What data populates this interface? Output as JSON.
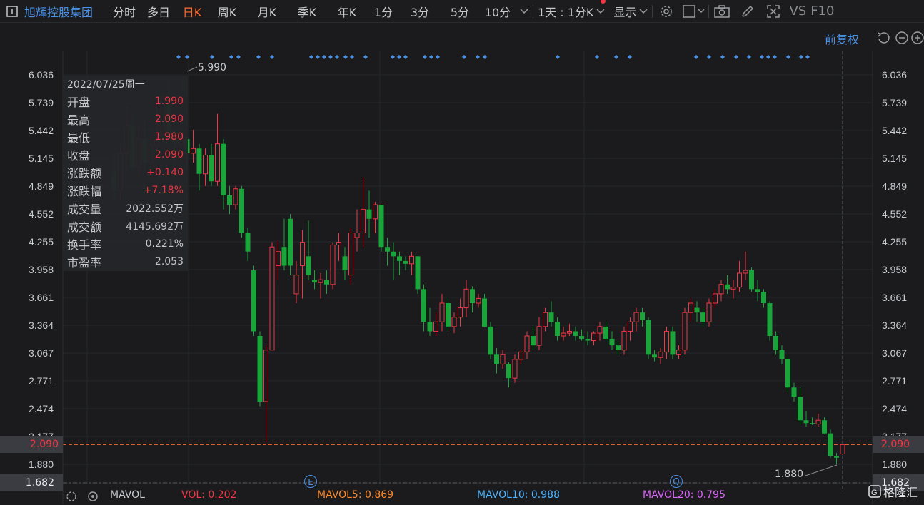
{
  "toolbar": {
    "title": "旭辉控股集团",
    "tabs": [
      "分时",
      "多日",
      "日K",
      "周K",
      "月K",
      "季K",
      "年K",
      "1分",
      "3分",
      "5分",
      "10分"
    ],
    "active_tab": "日K",
    "period": "1天 : 1分K",
    "display": "显示",
    "vs": "VS",
    "f10": "F10"
  },
  "subbar": {
    "fq": "前复权"
  },
  "info": {
    "date": "2022/07/25周一",
    "rows": [
      {
        "label": "开盘",
        "value": "1.990",
        "color": "#f23645"
      },
      {
        "label": "最高",
        "value": "2.090",
        "color": "#f23645"
      },
      {
        "label": "最低",
        "value": "1.980",
        "color": "#f23645"
      },
      {
        "label": "收盘",
        "value": "2.090",
        "color": "#f23645"
      },
      {
        "label": "涨跌额",
        "value": "+0.140",
        "color": "#f23645"
      },
      {
        "label": "涨跌幅",
        "value": "+7.18%",
        "color": "#f23645"
      },
      {
        "label": "成交量",
        "value": "2022.552万",
        "color": "#c9ccd1"
      },
      {
        "label": "成交额",
        "value": "4145.692万",
        "color": "#c9ccd1"
      },
      {
        "label": "换手率",
        "value": "0.221%",
        "color": "#c9ccd1"
      },
      {
        "label": "市盈率",
        "value": "2.053",
        "color": "#c9ccd1"
      }
    ]
  },
  "chart_data": {
    "type": "candlestick",
    "y_ticks": [
      "6.036",
      "5.739",
      "5.442",
      "5.145",
      "4.849",
      "4.552",
      "4.255",
      "3.958",
      "3.661",
      "3.364",
      "3.067",
      "2.771",
      "2.474",
      "2.177",
      "1.880",
      "1.682"
    ],
    "ylim": [
      1.682,
      6.036
    ],
    "current_price": "2.090",
    "low_marker": "1.682",
    "max_label": "5.990",
    "min_label": "1.880",
    "candles": [
      [
        5.0,
        5.2,
        4.7,
        4.8
      ],
      [
        4.8,
        5.3,
        4.7,
        5.2
      ],
      [
        5.2,
        5.7,
        5.0,
        5.5
      ],
      [
        5.5,
        5.6,
        5.0,
        5.05
      ],
      [
        5.05,
        5.5,
        4.95,
        5.35
      ],
      [
        5.35,
        5.55,
        5.0,
        5.1
      ],
      [
        5.1,
        5.35,
        5.0,
        5.28
      ],
      [
        5.28,
        5.72,
        5.2,
        5.4
      ],
      [
        5.4,
        5.85,
        5.3,
        5.8
      ],
      [
        5.8,
        5.99,
        5.3,
        5.35
      ],
      [
        5.35,
        5.45,
        5.1,
        5.3
      ],
      [
        5.3,
        5.4,
        5.15,
        5.35
      ],
      [
        5.35,
        5.38,
        5.05,
        5.2
      ],
      [
        5.2,
        5.45,
        5.1,
        5.25
      ],
      [
        5.25,
        5.3,
        4.8,
        4.98
      ],
      [
        4.98,
        5.25,
        4.85,
        5.18
      ],
      [
        5.18,
        5.3,
        4.85,
        4.9
      ],
      [
        4.9,
        5.62,
        4.85,
        5.3
      ],
      [
        5.3,
        5.35,
        4.6,
        4.75
      ],
      [
        4.75,
        4.85,
        4.55,
        4.65
      ],
      [
        4.65,
        4.85,
        4.6,
        4.82
      ],
      [
        4.82,
        4.85,
        4.3,
        4.35
      ],
      [
        4.35,
        4.4,
        4.05,
        4.15
      ],
      [
        3.95,
        4.0,
        3.25,
        3.3
      ],
      [
        3.25,
        3.3,
        2.5,
        2.55
      ],
      [
        2.55,
        3.15,
        2.12,
        3.1
      ],
      [
        3.1,
        4.25,
        3.1,
        4.2
      ],
      [
        4.0,
        4.27,
        3.85,
        4.15
      ],
      [
        4.2,
        4.5,
        3.95,
        4.0
      ],
      [
        4.5,
        4.55,
        3.9,
        4.0
      ],
      [
        3.7,
        4.05,
        3.6,
        3.9
      ],
      [
        4.0,
        4.38,
        3.65,
        4.25
      ],
      [
        4.1,
        4.48,
        3.85,
        3.9
      ],
      [
        3.85,
        3.95,
        3.75,
        3.82
      ],
      [
        3.82,
        3.92,
        3.65,
        3.85
      ],
      [
        3.85,
        3.95,
        3.7,
        3.8
      ],
      [
        3.8,
        4.25,
        3.75,
        4.22
      ],
      [
        4.22,
        4.35,
        4.05,
        4.25
      ],
      [
        4.1,
        4.2,
        3.85,
        3.95
      ],
      [
        3.9,
        4.4,
        3.8,
        4.35
      ],
      [
        4.3,
        4.6,
        4.15,
        4.35
      ],
      [
        4.35,
        4.94,
        4.2,
        4.6
      ],
      [
        4.6,
        4.8,
        4.3,
        4.5
      ],
      [
        4.5,
        4.68,
        4.35,
        4.65
      ],
      [
        4.65,
        4.65,
        4.15,
        4.2
      ],
      [
        4.2,
        4.3,
        4.0,
        4.15
      ],
      [
        4.15,
        4.25,
        3.85,
        4.1
      ],
      [
        4.1,
        4.15,
        3.9,
        4.05
      ],
      [
        4.05,
        4.1,
        3.95,
        4.02
      ],
      [
        4.02,
        4.15,
        3.9,
        4.1
      ],
      [
        4.1,
        4.1,
        3.7,
        3.75
      ],
      [
        3.75,
        3.8,
        3.3,
        3.4
      ],
      [
        3.4,
        3.55,
        3.25,
        3.3
      ],
      [
        3.3,
        3.5,
        3.25,
        3.4
      ],
      [
        3.4,
        3.7,
        3.3,
        3.6
      ],
      [
        3.6,
        3.65,
        3.3,
        3.35
      ],
      [
        3.35,
        3.5,
        3.28,
        3.45
      ],
      [
        3.45,
        3.65,
        3.35,
        3.55
      ],
      [
        3.55,
        3.85,
        3.45,
        3.75
      ],
      [
        3.75,
        3.78,
        3.5,
        3.6
      ],
      [
        3.6,
        3.7,
        3.55,
        3.65
      ],
      [
        3.65,
        3.7,
        3.35,
        3.35
      ],
      [
        3.35,
        3.4,
        3.0,
        3.05
      ],
      [
        3.05,
        3.12,
        2.85,
        2.95
      ],
      [
        2.95,
        3.1,
        2.9,
        3.05
      ],
      [
        2.95,
        2.97,
        2.7,
        2.8
      ],
      [
        2.8,
        3.05,
        2.75,
        3.0
      ],
      [
        3.0,
        3.1,
        2.95,
        3.08
      ],
      [
        3.08,
        3.3,
        3.0,
        3.25
      ],
      [
        3.25,
        3.35,
        3.1,
        3.15
      ],
      [
        3.15,
        3.45,
        3.1,
        3.35
      ],
      [
        3.35,
        3.55,
        3.3,
        3.5
      ],
      [
        3.5,
        3.62,
        3.35,
        3.4
      ],
      [
        3.4,
        3.45,
        3.2,
        3.25
      ],
      [
        3.25,
        3.35,
        3.2,
        3.28
      ],
      [
        3.28,
        3.38,
        3.25,
        3.3
      ],
      [
        3.3,
        3.35,
        3.2,
        3.25
      ],
      [
        3.25,
        3.32,
        3.2,
        3.22
      ],
      [
        3.22,
        3.3,
        3.15,
        3.2
      ],
      [
        3.2,
        3.3,
        3.15,
        3.28
      ],
      [
        3.28,
        3.4,
        3.2,
        3.35
      ],
      [
        3.35,
        3.4,
        3.2,
        3.22
      ],
      [
        3.22,
        3.3,
        3.1,
        3.15
      ],
      [
        3.15,
        3.2,
        3.05,
        3.1
      ],
      [
        3.1,
        3.35,
        3.05,
        3.3
      ],
      [
        3.3,
        3.45,
        3.2,
        3.4
      ],
      [
        3.4,
        3.55,
        3.3,
        3.5
      ],
      [
        3.5,
        3.55,
        3.35,
        3.42
      ],
      [
        3.42,
        3.45,
        3.0,
        3.05
      ],
      [
        3.05,
        3.1,
        2.98,
        3.02
      ],
      [
        3.02,
        3.12,
        2.95,
        3.08
      ],
      [
        3.08,
        3.35,
        3.0,
        3.3
      ],
      [
        3.3,
        3.35,
        3.0,
        3.05
      ],
      [
        3.05,
        3.15,
        3.0,
        3.1
      ],
      [
        3.1,
        3.55,
        3.05,
        3.5
      ],
      [
        3.5,
        3.65,
        3.4,
        3.6
      ],
      [
        3.55,
        3.62,
        3.4,
        3.5
      ],
      [
        3.5,
        3.55,
        3.35,
        3.4
      ],
      [
        3.4,
        3.65,
        3.35,
        3.6
      ],
      [
        3.6,
        3.75,
        3.55,
        3.7
      ],
      [
        3.7,
        3.85,
        3.62,
        3.8
      ],
      [
        3.8,
        3.9,
        3.7,
        3.75
      ],
      [
        3.75,
        3.85,
        3.65,
        3.77
      ],
      [
        3.77,
        4.05,
        3.72,
        3.92
      ],
      [
        3.92,
        4.15,
        3.85,
        3.95
      ],
      [
        3.95,
        3.98,
        3.72,
        3.75
      ],
      [
        3.75,
        3.85,
        3.62,
        3.72
      ],
      [
        3.72,
        3.75,
        3.55,
        3.6
      ],
      [
        3.6,
        3.62,
        3.2,
        3.25
      ],
      [
        3.25,
        3.3,
        3.05,
        3.1
      ],
      [
        3.1,
        3.15,
        2.95,
        3.0
      ],
      [
        3.0,
        3.05,
        2.65,
        2.7
      ],
      [
        2.7,
        2.75,
        2.55,
        2.6
      ],
      [
        2.6,
        2.7,
        2.3,
        2.35
      ],
      [
        2.35,
        2.45,
        2.28,
        2.32
      ],
      [
        2.32,
        2.38,
        2.3,
        2.31
      ],
      [
        2.31,
        2.42,
        2.28,
        2.35
      ],
      [
        2.35,
        2.38,
        2.2,
        2.21
      ],
      [
        2.21,
        2.25,
        1.95,
        1.97
      ],
      [
        1.97,
        2.0,
        1.88,
        1.95
      ],
      [
        1.99,
        2.09,
        1.98,
        2.09
      ]
    ]
  },
  "dot_markers": [
    "◆",
    "◆",
    "◆",
    "◆",
    "◆",
    "◆",
    "◆",
    "◆",
    "◆",
    "◆",
    "◆",
    "◆",
    "◆",
    "◆",
    "◆",
    "◆",
    "◆",
    "◆",
    "◆",
    "◆",
    "◆",
    "◆",
    "◆",
    "◆",
    "◆",
    "◆",
    "◆",
    "◆",
    "◆",
    "◆",
    "◆",
    "◆",
    "◆",
    "◆",
    "◆",
    "◆",
    "◆",
    "◆",
    "◆"
  ],
  "badges": [
    "E",
    "Q"
  ],
  "bottom": {
    "mavol": "MAVOL",
    "vol": "VOL: 0.202",
    "mavol5": "MAVOL5: 0.869",
    "mavol10": "MAVOL10: 0.988",
    "mavol20": "MAVOL20: 0.795"
  },
  "colors": {
    "up": "#f23645",
    "down": "#1aa53a",
    "dots": "#4a90e2",
    "accent": "#ff6a2b",
    "bg": "#1b1b1d"
  },
  "watermark": "格隆汇"
}
